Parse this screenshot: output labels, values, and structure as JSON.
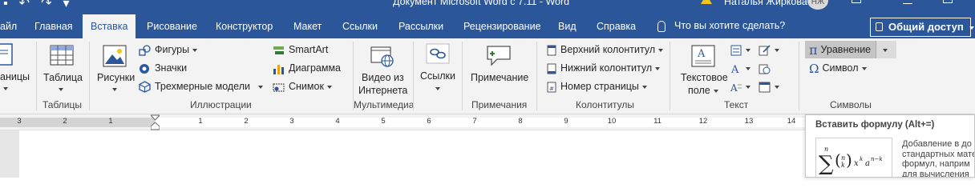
{
  "titlebar": {
    "doc_title": "Документ Microsoft Word с 7.11  -  Word",
    "user_name": "Наталья Жиркова",
    "avatar_initials": "НЖ",
    "qat_icons": [
      "undo-icon",
      "redo-icon",
      "customize-icon"
    ],
    "warning_icon": "warning-icon"
  },
  "tabs": {
    "items": [
      {
        "label": "айл"
      },
      {
        "label": "Главная"
      },
      {
        "label": "Вставка"
      },
      {
        "label": "Рисование"
      },
      {
        "label": "Конструктор"
      },
      {
        "label": "Макет"
      },
      {
        "label": "Ссылки"
      },
      {
        "label": "Рассылки"
      },
      {
        "label": "Рецензирование"
      },
      {
        "label": "Вид"
      },
      {
        "label": "Справка"
      }
    ],
    "active": "Вставка",
    "tell_me": "Что вы хотите сделать?",
    "share": "Общий доступ"
  },
  "ribbon": {
    "pages": {
      "label": "аницы"
    },
    "tables": {
      "table_button": "Таблица",
      "group_label": "Таблицы"
    },
    "illustrations": {
      "pictures": "Рисунки",
      "shapes": "Фигуры",
      "icons": "Значки",
      "models": "Трехмерные модели",
      "smartart": "SmartArt",
      "chart": "Диаграмма",
      "screenshot": "Снимок",
      "group_label": "Иллюстрации"
    },
    "media": {
      "video_line1": "Видео из",
      "video_line2": "Интернета",
      "group_label": "Мультимедиа"
    },
    "links": {
      "links_button": "Ссылки"
    },
    "comments": {
      "comment_button": "Примечание",
      "group_label": "Примечания"
    },
    "header_footer": {
      "header": "Верхний колонтитул",
      "footer": "Нижний колонтитул",
      "page_number": "Номер страницы",
      "group_label": "Колонтитулы"
    },
    "text": {
      "textbox_line1": "Текстовое",
      "textbox_line2": "поле",
      "group_label": "Текст"
    },
    "symbols": {
      "equation": "Уравнение",
      "symbol": "Символ",
      "group_label": "Символы"
    }
  },
  "ruler": {
    "left_numbers": [
      "3",
      "2",
      "1"
    ],
    "right_numbers": [
      "1",
      "2",
      "3",
      "4",
      "5",
      "6",
      "7",
      "8",
      "9",
      "10",
      "11",
      "12",
      "13",
      "14"
    ]
  },
  "tooltip": {
    "title": "Вставить формулу (Alt+=)",
    "desc_lines": [
      "Добавление в до",
      "стандартных мате",
      "формул, наприм",
      "для вычисления"
    ]
  },
  "colors": {
    "accent": "#2b579a",
    "ribbon_bg": "#f3f3f3",
    "equation_highlight": "#c5c5c5",
    "warning": "#f0c419"
  }
}
